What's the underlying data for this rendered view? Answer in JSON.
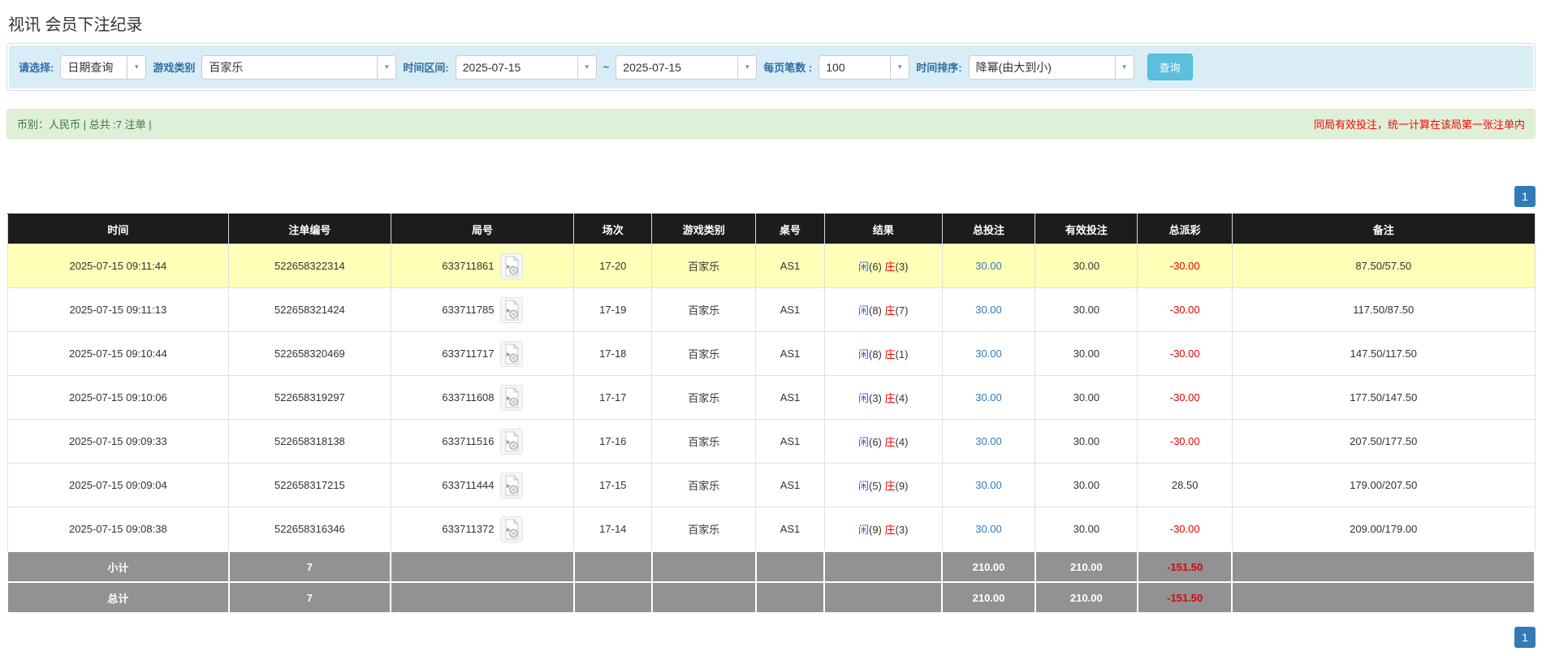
{
  "page": {
    "title": "视讯 会员下注纪录"
  },
  "filters": {
    "select_label": "请选择:",
    "select_value": "日期查询",
    "game_type_label": "游戏类别",
    "game_type_value": "百家乐",
    "time_range_label": "时间区间:",
    "date_from": "2025-07-15",
    "tilde": "~",
    "date_to": "2025-07-15",
    "page_size_label": "每页笔数 :",
    "page_size_value": "100",
    "sort_label": "时间排序:",
    "sort_value": "降幂(由大到小)",
    "search_button": "查询"
  },
  "summary": {
    "left": "币别：人民币 | 总共 :7 注单 |",
    "right": "同局有效投注，统一计算在该局第一张注单内"
  },
  "pagination": {
    "page": "1"
  },
  "table": {
    "headers": [
      "时间",
      "注单编号",
      "局号",
      "场次",
      "游戏类别",
      "桌号",
      "结果",
      "总投注",
      "有效投注",
      "总派彩",
      "备注"
    ],
    "rows": [
      {
        "time": "2025-07-15 09:11:44",
        "bet_id": "522658322314",
        "round_id": "633711861",
        "session": "17-20",
        "game": "百家乐",
        "table_id": "AS1",
        "result": {
          "player_label": "闲",
          "player": "6",
          "banker_label": "庄",
          "banker": "3"
        },
        "total_bet": "30.00",
        "valid_bet": "30.00",
        "payout": "-30.00",
        "remark": "87.50/57.50",
        "highlight": true
      },
      {
        "time": "2025-07-15 09:11:13",
        "bet_id": "522658321424",
        "round_id": "633711785",
        "session": "17-19",
        "game": "百家乐",
        "table_id": "AS1",
        "result": {
          "player_label": "闲",
          "player": "8",
          "banker_label": "庄",
          "banker": "7"
        },
        "total_bet": "30.00",
        "valid_bet": "30.00",
        "payout": "-30.00",
        "remark": "117.50/87.50",
        "highlight": false
      },
      {
        "time": "2025-07-15 09:10:44",
        "bet_id": "522658320469",
        "round_id": "633711717",
        "session": "17-18",
        "game": "百家乐",
        "table_id": "AS1",
        "result": {
          "player_label": "闲",
          "player": "8",
          "banker_label": "庄",
          "banker": "1"
        },
        "total_bet": "30.00",
        "valid_bet": "30.00",
        "payout": "-30.00",
        "remark": "147.50/117.50",
        "highlight": false
      },
      {
        "time": "2025-07-15 09:10:06",
        "bet_id": "522658319297",
        "round_id": "633711608",
        "session": "17-17",
        "game": "百家乐",
        "table_id": "AS1",
        "result": {
          "player_label": "闲",
          "player": "3",
          "banker_label": "庄",
          "banker": "4"
        },
        "total_bet": "30.00",
        "valid_bet": "30.00",
        "payout": "-30.00",
        "remark": "177.50/147.50",
        "highlight": false
      },
      {
        "time": "2025-07-15 09:09:33",
        "bet_id": "522658318138",
        "round_id": "633711516",
        "session": "17-16",
        "game": "百家乐",
        "table_id": "AS1",
        "result": {
          "player_label": "闲",
          "player": "6",
          "banker_label": "庄",
          "banker": "4"
        },
        "total_bet": "30.00",
        "valid_bet": "30.00",
        "payout": "-30.00",
        "remark": "207.50/177.50",
        "highlight": false
      },
      {
        "time": "2025-07-15 09:09:04",
        "bet_id": "522658317215",
        "round_id": "633711444",
        "session": "17-15",
        "game": "百家乐",
        "table_id": "AS1",
        "result": {
          "player_label": "闲",
          "player": "5",
          "banker_label": "庄",
          "banker": "9"
        },
        "total_bet": "30.00",
        "valid_bet": "30.00",
        "payout": "28.50",
        "remark": "179.00/207.50",
        "highlight": false
      },
      {
        "time": "2025-07-15 09:08:38",
        "bet_id": "522658316346",
        "round_id": "633711372",
        "session": "17-14",
        "game": "百家乐",
        "table_id": "AS1",
        "result": {
          "player_label": "闲",
          "player": "9",
          "banker_label": "庄",
          "banker": "3"
        },
        "total_bet": "30.00",
        "valid_bet": "30.00",
        "payout": "-30.00",
        "remark": "209.00/179.00",
        "highlight": false
      }
    ],
    "footer": [
      {
        "label": "小计",
        "count": "7",
        "total_bet": "210.00",
        "valid_bet": "210.00",
        "payout": "-151.50"
      },
      {
        "label": "总计",
        "count": "7",
        "total_bet": "210.00",
        "valid_bet": "210.00",
        "payout": "-151.50"
      }
    ]
  },
  "colors": {
    "filter_bar_bg": "#d9edf7",
    "search_button_bg": "#5bc0de",
    "summary_bg": "#dff0d8",
    "summary_text_green": "#3c763d",
    "notice_red": "#ff0000",
    "header_black": "#1c1c1c",
    "footer_gray": "#929292",
    "highlight_yellow": "#ffffb8",
    "link_blue": "#337ab7",
    "player_blue": "#3366cc",
    "banker_red": "#e60000",
    "negative_red": "#e60000"
  }
}
